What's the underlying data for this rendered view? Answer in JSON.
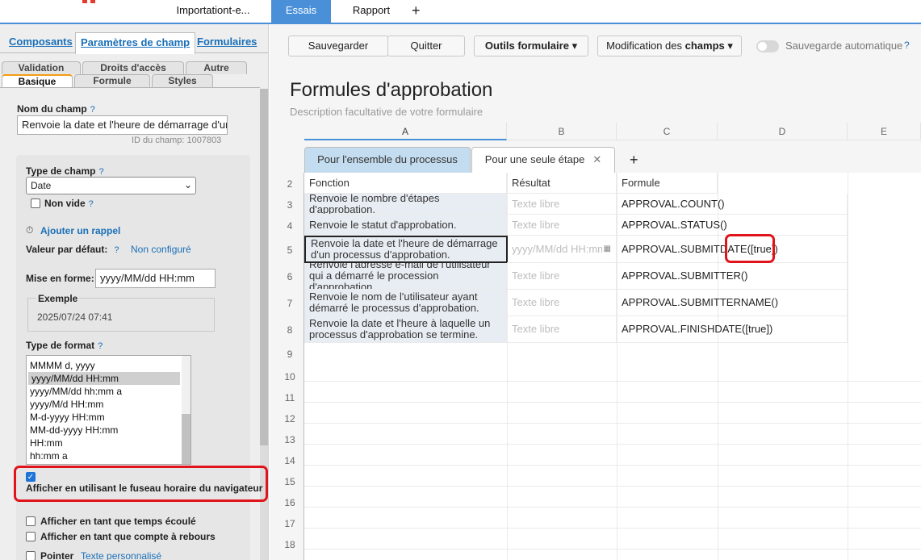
{
  "top": {
    "tabs": [
      {
        "label": "Importationt-e..."
      },
      {
        "label": "Essais"
      },
      {
        "label": "Rapport"
      }
    ],
    "add_label": "+"
  },
  "left": {
    "tabs1": [
      "Composants",
      "Paramètres de champ",
      "Formulaires"
    ],
    "tabs2_row1": [
      "Validation",
      "Droits d'accès",
      "Autre"
    ],
    "tabs2_row2": [
      "Basique",
      "Formule",
      "Styles"
    ],
    "field_name_label": "Nom du champ",
    "field_name_value": "Renvoie la date et l'heure de démarrage d'un",
    "field_id": "ID du champ: 1007803",
    "field_type_label": "Type de champ",
    "field_type_value": "Date",
    "non_vide": "Non vide",
    "add_reminder": "Ajouter un rappel",
    "default_value_label": "Valeur par défaut:",
    "default_value": "Non configuré",
    "format_label": "Mise en forme:",
    "format_value": "yyyy/MM/dd HH:mm",
    "example_label": "Exemple",
    "example_value": "2025/07/24 07:41",
    "format_type_label": "Type de format",
    "format_options": [
      "MMMM d, yyyy",
      "yyyy/MM/dd HH:mm",
      "yyyy/MM/dd hh:mm a",
      "yyyy/M/d HH:mm",
      "M-d-yyyy HH:mm",
      "MM-dd-yyyy HH:mm",
      "HH:mm",
      "hh:mm a"
    ],
    "selected_format": "yyyy/MM/dd HH:mm",
    "browser_tz": "Afficher en utilisant le fuseau horaire du navigateur",
    "elapsed": "Afficher en tant que temps écoulé",
    "countdown": "Afficher en tant que compte à rebours",
    "pointer": "Pointer",
    "custom_text": "Texte personnalisé",
    "help": "?"
  },
  "toolbar": {
    "save": "Sauvegarder",
    "quit": "Quitter",
    "tools": "Outils formulaire",
    "modif_prefix": "Modification des ",
    "modif_bold": "champs",
    "autosave": "Sauvegarde automatique",
    "help": "?"
  },
  "form": {
    "title": "Formules d'approbation",
    "description": "Description facultative de votre formulaire"
  },
  "sheet": {
    "columns": [
      "A",
      "B",
      "C",
      "D",
      "E"
    ],
    "tabs": [
      "Pour l'ensemble du processus",
      "Pour une seule étape"
    ],
    "close_label": "✕",
    "add_label": "+",
    "headers": [
      "Fonction",
      "Résultat",
      "Formule"
    ],
    "rows": [
      {
        "num": "3",
        "fn": "Renvoie le nombre d'étapes d'approbation.",
        "res": "Texte libre",
        "formula": "APPROVAL.COUNT()"
      },
      {
        "num": "4",
        "fn": "Renvoie le statut d'approbation.",
        "res": "Texte libre",
        "formula": "APPROVAL.STATUS()"
      },
      {
        "num": "5",
        "fn": "Renvoie la date et l'heure de démarrage d'un processus d'approbation.",
        "res": "yyyy/MM/dd HH:mm",
        "formula_a": "APPROVAL.SUBMITDATE",
        "formula_b": "([true])"
      },
      {
        "num": "6",
        "fn": "Renvoie l'adresse e-mail de l'utilisateur qui a démarré le procession d'approbation.",
        "res": "Texte libre",
        "formula": "APPROVAL.SUBMITTER()"
      },
      {
        "num": "7",
        "fn": "Renvoie le nom de l'utilisateur ayant démarré le processus d'approbation.",
        "res": "Texte libre",
        "formula": "APPROVAL.SUBMITTERNAME()"
      },
      {
        "num": "8",
        "fn": "Renvoie la date et l'heure à laquelle un processus d'approbation se termine.",
        "res": "Texte libre",
        "formula": "APPROVAL.FINISHDATE([true])"
      }
    ],
    "row_numbers": [
      "2",
      "3",
      "4",
      "5",
      "6",
      "7",
      "8",
      "9",
      "10",
      "11",
      "12",
      "13",
      "14",
      "15",
      "16",
      "17",
      "18"
    ]
  },
  "icons": [
    "clock-icon",
    "calendar-icon",
    "chevron-down-icon",
    "close-icon",
    "plus-icon",
    "check-icon"
  ],
  "colors": {
    "accent": "#4a90d9",
    "highlight": "#e0141b",
    "tab_blue": "#c4dcef",
    "cell_blue": "#e8edf3"
  }
}
